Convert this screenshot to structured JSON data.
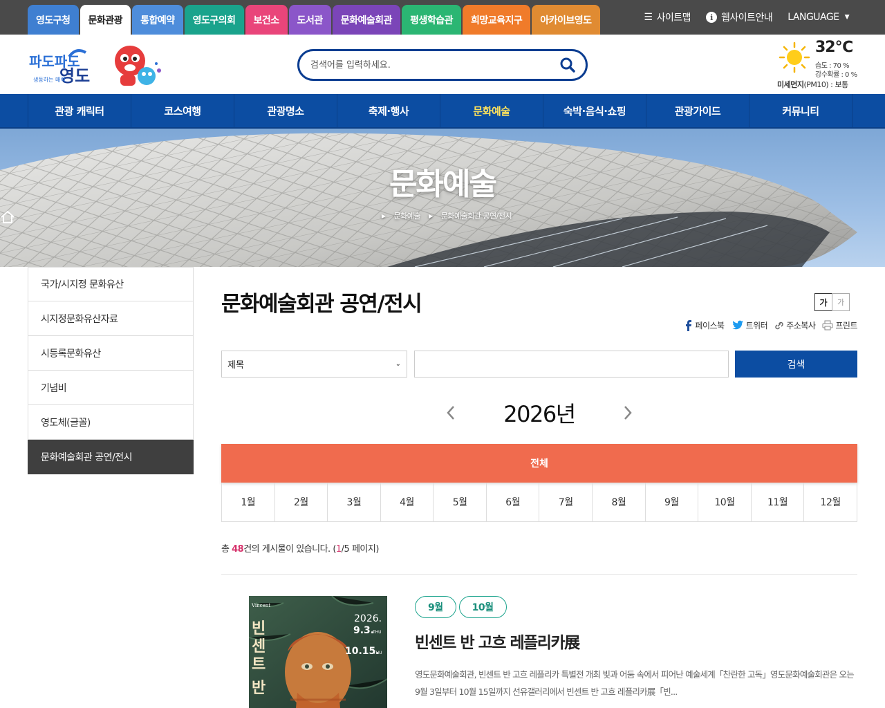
{
  "site_tabs": [
    {
      "label": "영도구청",
      "color": "#3f7fd1"
    },
    {
      "label": "문화관광",
      "color": "#ffffff",
      "active": true
    },
    {
      "label": "통합예약",
      "color": "#4e8ddb"
    },
    {
      "label": "영도구의회",
      "color": "#1aa38c"
    },
    {
      "label": "보건소",
      "color": "#e9457a"
    },
    {
      "label": "도서관",
      "color": "#8b56c9"
    },
    {
      "label": "문화예술회관",
      "color": "#7b45b8"
    },
    {
      "label": "평생학습관",
      "color": "#2bb673"
    },
    {
      "label": "희망교육지구",
      "color": "#f07b2a"
    },
    {
      "label": "아카이브영도",
      "color": "#e08b32"
    }
  ],
  "util": {
    "sitemap": "사이트맵",
    "guide": "웹사이트안내",
    "language": "LANGUAGE"
  },
  "search": {
    "placeholder": "검색어를 입력하세요."
  },
  "weather": {
    "temp": "32℃",
    "humidity": "습도 : 70 %",
    "rain": "강수확률 : 0 %",
    "dust_label": "미세먼지",
    "dust_value": "(PM10) : 보통"
  },
  "gnb": [
    {
      "label": "관광 캐릭터"
    },
    {
      "label": "코스여행"
    },
    {
      "label": "관광명소"
    },
    {
      "label": "축제·행사"
    },
    {
      "label": "문화예술",
      "active": true
    },
    {
      "label": "숙박·음식·쇼핑"
    },
    {
      "label": "관광가이드"
    },
    {
      "label": "커뮤니티"
    }
  ],
  "hero": {
    "title": "문화예술",
    "breadcrumb": [
      "문화예술",
      "문화예술회관 공연/전시"
    ]
  },
  "lnb": [
    {
      "label": "국가/시지정 문화유산"
    },
    {
      "label": "시지정문화유산자료"
    },
    {
      "label": "시등록문화유산"
    },
    {
      "label": "기념비"
    },
    {
      "label": "영도체(글꼴)"
    },
    {
      "label": "문화예술회관 공연/전시",
      "active": true
    }
  ],
  "content": {
    "title": "문화예술회관 공연/전시",
    "font_big": "가",
    "font_small": "가",
    "share": {
      "facebook": "페이스북",
      "twitter": "트위터",
      "copy": "주소복사",
      "print": "프린트"
    }
  },
  "filter": {
    "select_value": "제목",
    "search_button": "검색"
  },
  "calendar": {
    "year": "2026년",
    "all": "전체",
    "months": [
      "1월",
      "2월",
      "3월",
      "4월",
      "5월",
      "6월",
      "7월",
      "8월",
      "9월",
      "10월",
      "11월",
      "12월"
    ]
  },
  "summary": {
    "prefix": "총 ",
    "count": "48",
    "mid": "건의 게시물이 있습니다. (",
    "current": "1",
    "suffix": "/5 페이지)"
  },
  "post": {
    "badges": [
      "9월",
      "10월"
    ],
    "title": "빈센트 반 고흐 레플리카展",
    "desc": "영도문화예술회관, 빈센트 반 고흐 레플리카 특별전 개최 빛과 어둠 속에서 피어난 예술세계「찬란한 고독」영도문화예술회관은 오는 9월 3일부터 10월 15일까지 선유갤러리에서 빈센트 반 고흐 레플리카展「빈...",
    "poster": {
      "vertical_title": [
        "빈",
        "센",
        "트",
        "반"
      ],
      "year": "2026.",
      "start": "9.3.",
      "start_day": "THU",
      "end": "10.15.",
      "end_day": "THU",
      "caption": "Vincent"
    }
  },
  "logo": {
    "text_top": "파도파도",
    "text_main": "영도",
    "tagline": "생동하는 매력"
  },
  "colors": {
    "primary": "#0c4da2",
    "accent": "#f06b4e",
    "badge": "#1aa38c"
  }
}
